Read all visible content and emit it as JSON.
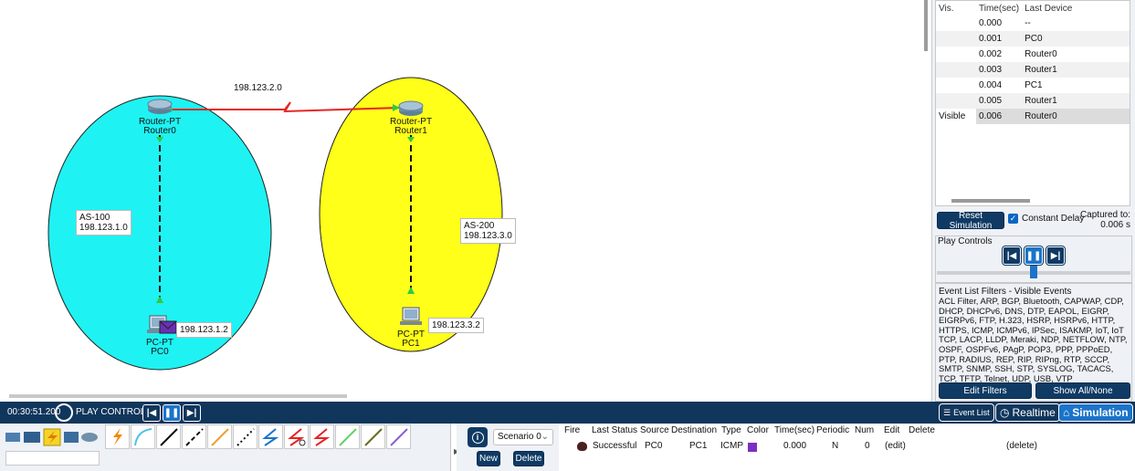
{
  "workspace": {
    "link_label": "198.123.2.0",
    "routers": [
      {
        "model": "Router-PT",
        "name": "Router0"
      },
      {
        "model": "Router-PT",
        "name": "Router1"
      }
    ],
    "pcs": [
      {
        "model": "PC-PT",
        "name": "PC0",
        "ip": "198.123.1.2"
      },
      {
        "model": "PC-PT",
        "name": "PC1",
        "ip": "198.123.3.2"
      }
    ],
    "areas": [
      {
        "as": "AS-100",
        "network": "198.123.1.0",
        "color": "#1ff2f2"
      },
      {
        "as": "AS-200",
        "network": "198.123.3.0",
        "color": "#ffff1a"
      }
    ]
  },
  "event_list": {
    "headers": [
      "Vis.",
      "Time(sec)",
      "Last Device"
    ],
    "rows": [
      {
        "vis": "",
        "time": "0.000",
        "device": "--"
      },
      {
        "vis": "",
        "time": "0.001",
        "device": "PC0"
      },
      {
        "vis": "",
        "time": "0.002",
        "device": "Router0"
      },
      {
        "vis": "",
        "time": "0.003",
        "device": "Router1"
      },
      {
        "vis": "",
        "time": "0.004",
        "device": "PC1"
      },
      {
        "vis": "",
        "time": "0.005",
        "device": "Router1"
      },
      {
        "vis": "Visible",
        "time": "0.006",
        "device": "Router0"
      }
    ]
  },
  "sim_panel": {
    "reset_label": "Reset Simulation",
    "constant_delay_label": "Constant Delay",
    "captured_label": "Captured to:",
    "captured_value": "0.006 s",
    "play_controls_title": "Play Controls",
    "filters_title": "Event List Filters - Visible Events",
    "filters_text": "ACL Filter, ARP, BGP, Bluetooth, CAPWAP, CDP, DHCP, DHCPv6, DNS, DTP, EAPOL, EIGRP, EIGRPv6, FTP, H.323, HSRP, HSRPv6, HTTP, HTTPS, ICMP, ICMPv6, IPSec, ISAKMP, IoT, IoT TCP, LACP, LLDP, Meraki, NDP, NETFLOW, NTP, OSPF, OSPFv6, PAgP, POP3, PPP, PPPoED, PTP, RADIUS, REP, RIP, RIPng, RTP, SCCP, SMTP, SNMP, SSH, STP, SYSLOG, TACACS, TCP, TFTP, Telnet, UDP, USB, VTP",
    "edit_filters_label": "Edit Filters",
    "show_all_label": "Show All/None"
  },
  "bottom_bar": {
    "time": "00:30:51.200",
    "play_controls_label": "PLAY CONTROLS:",
    "event_list_label": "Event List",
    "realtime_label": "Realtime",
    "simulation_label": "Simulation"
  },
  "scenario": {
    "selected": "Scenario 0",
    "new_label": "New",
    "delete_label": "Delete"
  },
  "pdu_table": {
    "headers": [
      "Fire",
      "Last Status",
      "Source",
      "Destination",
      "Type",
      "Color",
      "Time(sec)",
      "Periodic",
      "Num",
      "Edit",
      "Delete"
    ],
    "rows": [
      {
        "status": "Successful",
        "source": "PC0",
        "destination": "PC1",
        "type": "ICMP",
        "color": "#7b2fc2",
        "time": "0.000",
        "periodic": "N",
        "num": "0",
        "edit": "(edit)",
        "delete": "(delete)"
      }
    ]
  },
  "colors": {
    "bar": "#10365c",
    "link_red": "#e82222",
    "accent": "#1b74c9"
  }
}
